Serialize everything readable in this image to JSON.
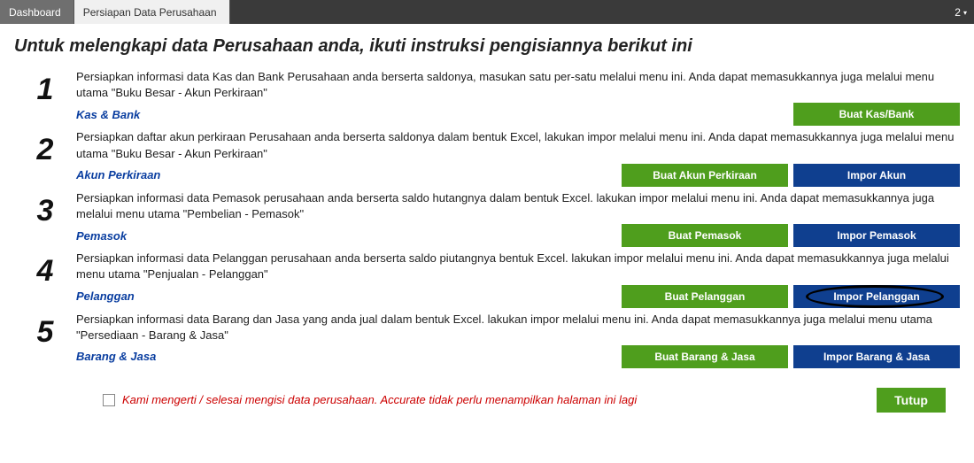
{
  "topbar": {
    "tab_dashboard": "Dashboard",
    "tab_active": "Persiapan Data Perusahaan",
    "badge": "2"
  },
  "title": "Untuk melengkapi data Perusahaan anda, ikuti instruksi pengisiannya berikut ini",
  "steps": [
    {
      "num": "1",
      "desc": "Persiapkan informasi data Kas dan Bank Perusahaan anda berserta saldonya, masukan satu per-satu melalui menu ini. Anda dapat memasukkannya juga melalui menu utama \"Buku Besar - Akun Perkiraan\"",
      "link": "Kas & Bank",
      "btn_green": "Buat Kas/Bank",
      "btn_blue": ""
    },
    {
      "num": "2",
      "desc": "Persiapkan daftar akun perkiraan Perusahaan anda berserta saldonya dalam bentuk Excel, lakukan impor melalui menu ini. Anda dapat memasukkannya juga melalui menu utama \"Buku Besar - Akun Perkiraan\"",
      "link": "Akun Perkiraan",
      "btn_green": "Buat Akun Perkiraan",
      "btn_blue": "Impor Akun"
    },
    {
      "num": "3",
      "desc": "Persiapkan informasi data Pemasok perusahaan anda berserta saldo hutangnya dalam bentuk Excel. lakukan impor melalui menu ini. Anda dapat memasukkannya juga melalui menu utama \"Pembelian - Pemasok\"",
      "link": "Pemasok",
      "btn_green": "Buat Pemasok",
      "btn_blue": "Impor Pemasok"
    },
    {
      "num": "4",
      "desc": "Persiapkan informasi data Pelanggan perusahaan anda berserta saldo piutangnya bentuk Excel. lakukan impor melalui menu ini. Anda dapat memasukkannya juga melalui menu utama \"Penjualan - Pelanggan\"",
      "link": "Pelanggan",
      "btn_green": "Buat Pelanggan",
      "btn_blue": "Impor Pelanggan"
    },
    {
      "num": "5",
      "desc": "Persiapkan informasi data Barang dan Jasa yang anda jual dalam bentuk Excel. lakukan impor melalui menu ini. Anda dapat memasukkannya juga melalui menu utama \"Persediaan - Barang & Jasa\"",
      "link": "Barang & Jasa",
      "btn_green": "Buat Barang & Jasa",
      "btn_blue": "Impor Barang & Jasa"
    }
  ],
  "footer": {
    "confirm": "Kami mengerti / selesai mengisi data perusahaan. Accurate tidak perlu menampilkan halaman ini lagi",
    "close": "Tutup"
  }
}
